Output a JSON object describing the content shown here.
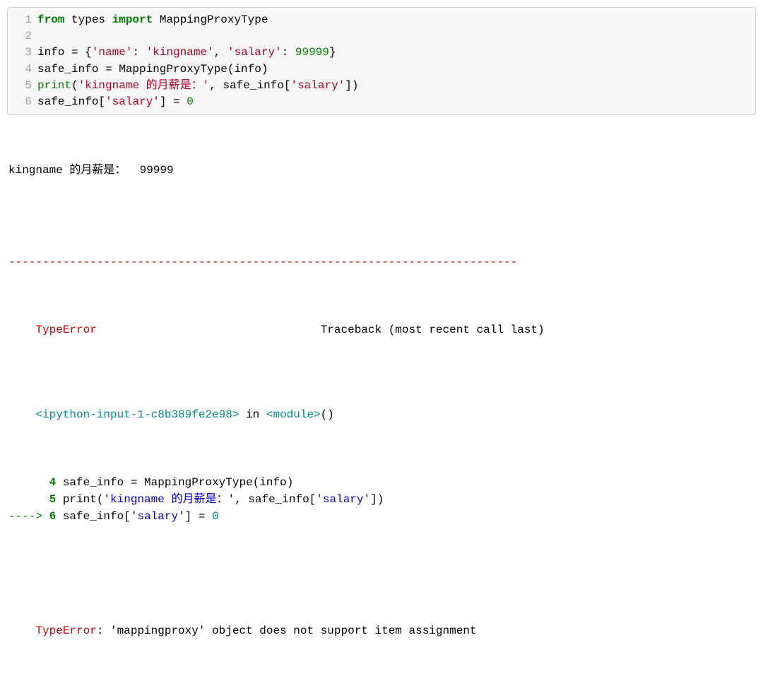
{
  "code": {
    "lines": [
      {
        "n": "1",
        "tokens": [
          {
            "cls": "k-green",
            "t": "from"
          },
          {
            "cls": "k-ident",
            "t": " types "
          },
          {
            "cls": "k-green",
            "t": "import"
          },
          {
            "cls": "k-ident",
            "t": " MappingProxyType"
          }
        ]
      },
      {
        "n": "2",
        "tokens": []
      },
      {
        "n": "3",
        "tokens": [
          {
            "cls": "k-ident",
            "t": "info "
          },
          {
            "cls": "k-op",
            "t": "="
          },
          {
            "cls": "k-ident",
            "t": " {"
          },
          {
            "cls": "k-str",
            "t": "'name'"
          },
          {
            "cls": "k-ident",
            "t": ": "
          },
          {
            "cls": "k-str",
            "t": "'kingname'"
          },
          {
            "cls": "k-ident",
            "t": ", "
          },
          {
            "cls": "k-str",
            "t": "'salary'"
          },
          {
            "cls": "k-ident",
            "t": ": "
          },
          {
            "cls": "k-num",
            "t": "99999"
          },
          {
            "cls": "k-ident",
            "t": "}"
          }
        ]
      },
      {
        "n": "4",
        "tokens": [
          {
            "cls": "k-ident",
            "t": "safe_info "
          },
          {
            "cls": "k-op",
            "t": "="
          },
          {
            "cls": "k-ident",
            "t": " MappingProxyType(info)"
          }
        ]
      },
      {
        "n": "5",
        "tokens": [
          {
            "cls": "k-builtin",
            "t": "print"
          },
          {
            "cls": "k-ident",
            "t": "("
          },
          {
            "cls": "k-str",
            "t": "'kingname 的月薪是：'"
          },
          {
            "cls": "k-ident",
            "t": ", safe_info["
          },
          {
            "cls": "k-str",
            "t": "'salary'"
          },
          {
            "cls": "k-ident",
            "t": "])"
          }
        ]
      },
      {
        "n": "6",
        "tokens": [
          {
            "cls": "k-ident",
            "t": "safe_info["
          },
          {
            "cls": "k-str",
            "t": "'salary'"
          },
          {
            "cls": "k-ident",
            "t": "] "
          },
          {
            "cls": "k-op",
            "t": "="
          },
          {
            "cls": "k-ident",
            "t": " "
          },
          {
            "cls": "k-num",
            "t": "0"
          }
        ]
      }
    ]
  },
  "output": {
    "stdout": "kingname 的月薪是：  99999",
    "separator": "---------------------------------------------------------------------------",
    "err_header": {
      "name": "TypeError",
      "right": "Traceback (most recent call last)"
    },
    "frame_loc": {
      "file": "<ipython-input-1-c8b389fe2e98>",
      "in": " in ",
      "module": "<module>",
      "tail": "()"
    },
    "tb_lines": [
      {
        "prefix": "      ",
        "n": "4",
        "rest": [
          {
            "cls": "tb-plain",
            "t": " safe_info "
          },
          {
            "cls": "tb-plain",
            "t": "="
          },
          {
            "cls": "tb-plain",
            "t": " MappingProxyType"
          },
          {
            "cls": "tb-plain",
            "t": "(info)"
          }
        ]
      },
      {
        "prefix": "      ",
        "n": "5",
        "rest": [
          {
            "cls": "tb-plain",
            "t": " print"
          },
          {
            "cls": "tb-plain",
            "t": "("
          },
          {
            "cls": "tb-blue",
            "t": "'kingname 的月薪是：'"
          },
          {
            "cls": "tb-plain",
            "t": ", safe_info["
          },
          {
            "cls": "tb-blue",
            "t": "'salary'"
          },
          {
            "cls": "tb-plain",
            "t": "])"
          }
        ]
      },
      {
        "prefix": "----> ",
        "n": "6",
        "rest": [
          {
            "cls": "tb-plain",
            "t": " safe_info["
          },
          {
            "cls": "tb-blue",
            "t": "'salary'"
          },
          {
            "cls": "tb-plain",
            "t": "] "
          },
          {
            "cls": "tb-plain",
            "t": "="
          },
          {
            "cls": "tb-plain",
            "t": " "
          },
          {
            "cls": "tb-cyan",
            "t": "0"
          }
        ]
      }
    ],
    "final": {
      "name": "TypeError",
      "msg": ": 'mappingproxy' object does not support item assignment"
    }
  }
}
